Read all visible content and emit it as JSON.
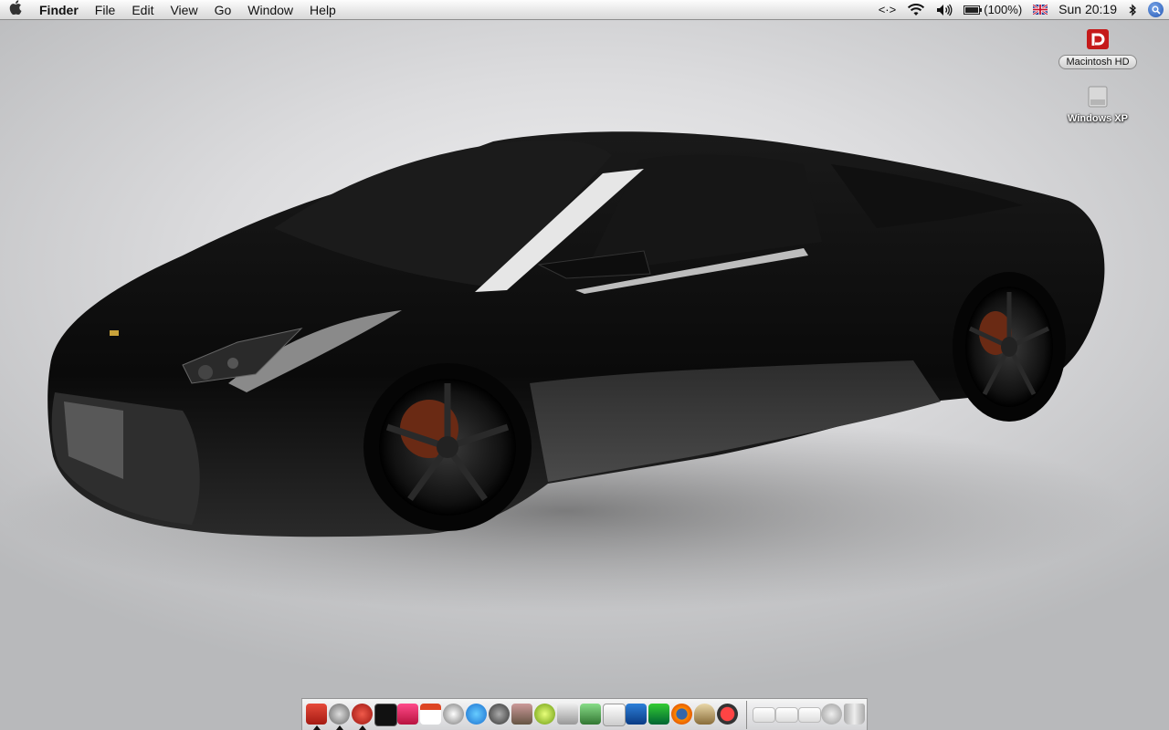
{
  "menubar": {
    "apple_icon": "apple-icon",
    "app_name": "Finder",
    "menus": [
      "File",
      "Edit",
      "View",
      "Go",
      "Window",
      "Help"
    ],
    "status": {
      "script_menu": "<·>",
      "wifi_icon": "wifi-icon",
      "volume_icon": "volume-icon",
      "battery_icon": "battery-icon",
      "battery_level": 1.0,
      "battery_text": "(100%)",
      "input_flag_icon": "uk-flag-icon",
      "clock": "Sun 20:19",
      "bluetooth_icon": "bluetooth-icon",
      "spotlight_icon": "spotlight-icon"
    }
  },
  "desktop": {
    "wallpaper": "black-sports-car-wallpaper",
    "icons": [
      {
        "name": "Macintosh HD",
        "icon": "hard-drive-icon",
        "selected": true
      },
      {
        "name": "Windows XP",
        "icon": "hard-drive-icon",
        "selected": false
      }
    ]
  },
  "dock": {
    "items": [
      {
        "icon": "finder-icon",
        "running": true
      },
      {
        "icon": "itunes-icon",
        "running": true
      },
      {
        "icon": "safari-icon",
        "running": true
      },
      {
        "icon": "terminal-icon",
        "running": false
      },
      {
        "icon": "photo-booth-icon",
        "running": false
      },
      {
        "icon": "ical-icon",
        "running": false
      },
      {
        "icon": "sync-icon",
        "running": false
      },
      {
        "icon": "quicktime-icon",
        "running": false
      },
      {
        "icon": "dashboard-icon",
        "running": false
      },
      {
        "icon": "iphoto-icon",
        "running": false
      },
      {
        "icon": "tennis-ball-icon",
        "running": false
      },
      {
        "icon": "preview-icon",
        "running": false
      },
      {
        "icon": "script-editor-icon",
        "running": false
      },
      {
        "icon": "textedit-icon",
        "running": false
      },
      {
        "icon": "word-icon",
        "running": false
      },
      {
        "icon": "excel-icon",
        "running": false
      },
      {
        "icon": "firefox-icon",
        "running": false
      },
      {
        "icon": "gimp-icon",
        "running": false
      },
      {
        "icon": "ichat-icon",
        "running": false
      }
    ],
    "folders": [
      "stack-folder-icon",
      "stack-folder-icon",
      "stack-folder-icon"
    ],
    "utility_icon": "network-utility-icon",
    "trash_icon": "trash-icon"
  }
}
